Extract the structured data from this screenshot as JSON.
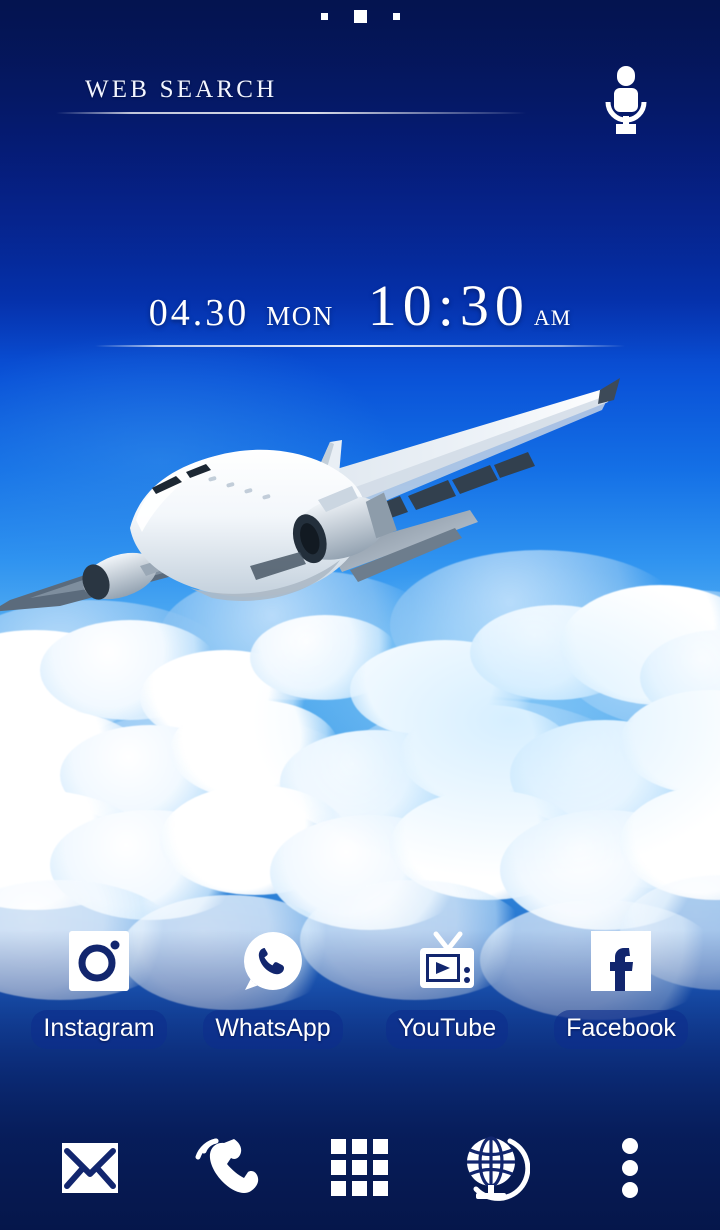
{
  "wallpaper": {
    "scene": "airplane-in-blue-sky-with-clouds",
    "sky_top_color": "#061c6e",
    "sky_mid_color": "#0a53d8",
    "sky_bright_color": "#57b0f2",
    "sky_bottom_color": "#081f57",
    "cloud_color": "#ffffff",
    "plane_color": "#f2f6fb"
  },
  "page_indicator": {
    "name": "page-dots",
    "total": 3,
    "active_index": 1
  },
  "search": {
    "label": "WEB SEARCH",
    "placeholder": "WEB SEARCH",
    "mic_icon": "microphone-icon",
    "search_icon": "search-icon"
  },
  "clock": {
    "date": "04.30",
    "weekday": "MON",
    "time": "10:30",
    "meridiem": "AM"
  },
  "apps": [
    {
      "name": "Instagram",
      "icon": "instagram-icon"
    },
    {
      "name": "WhatsApp",
      "icon": "whatsapp-icon"
    },
    {
      "name": "YouTube",
      "icon": "youtube-tv-icon"
    },
    {
      "name": "Facebook",
      "icon": "facebook-icon"
    }
  ],
  "dock": [
    {
      "name": "Mail",
      "icon": "mail-envelope-icon"
    },
    {
      "name": "Phone",
      "icon": "phone-handset-icon"
    },
    {
      "name": "Apps",
      "icon": "app-drawer-grid-icon"
    },
    {
      "name": "Browser",
      "icon": "globe-icon"
    },
    {
      "name": "More",
      "icon": "overflow-menu-icon"
    }
  ],
  "colors": {
    "accent": "#0d2d8c",
    "icon_dark": "#12266e",
    "icon_light": "#ffffff",
    "label_pill": "rgba(13,45,140,.62)"
  }
}
